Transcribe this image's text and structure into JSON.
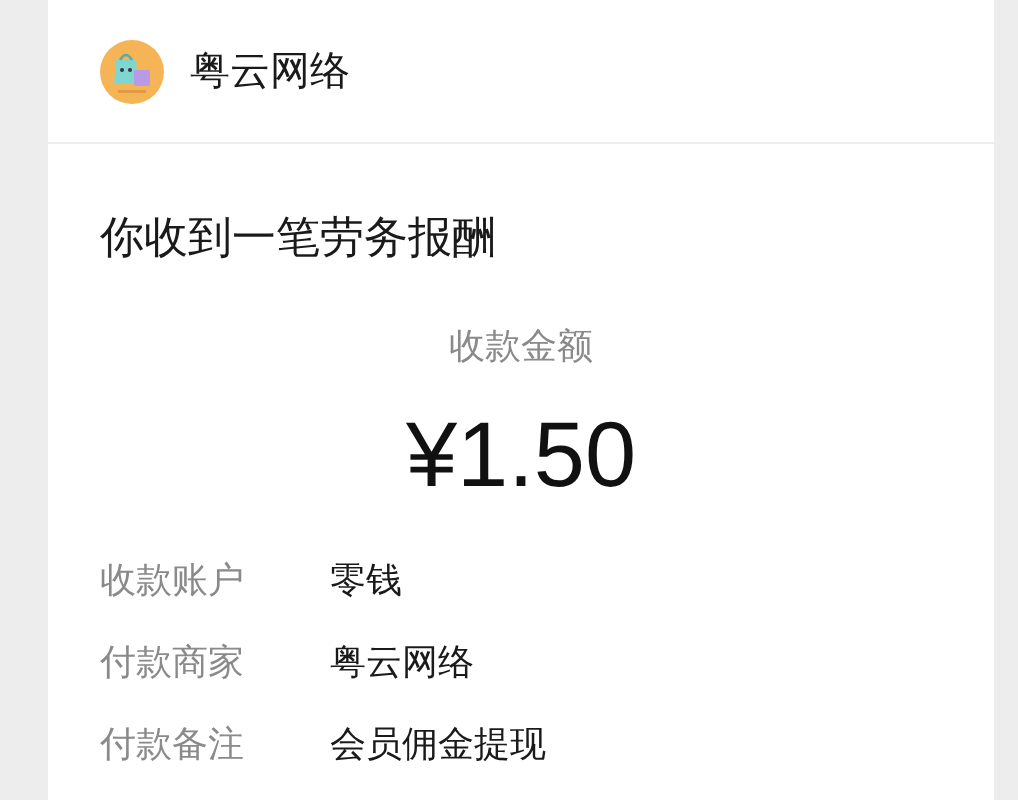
{
  "merchant": {
    "name": "粤云网络"
  },
  "message": {
    "title": "你收到一笔劳务报酬",
    "amount_label": "收款金额",
    "amount": "¥1.50"
  },
  "details": [
    {
      "label": "收款账户",
      "value": "零钱"
    },
    {
      "label": "付款商家",
      "value": "粤云网络"
    },
    {
      "label": "付款备注",
      "value": "会员佣金提现"
    }
  ]
}
